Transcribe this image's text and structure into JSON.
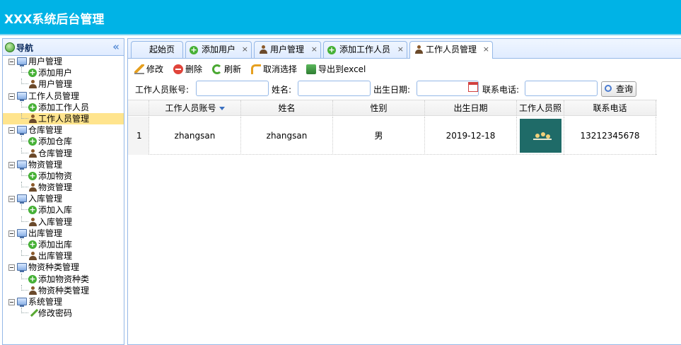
{
  "app": {
    "title": "XXX系统后台管理"
  },
  "sidebar": {
    "title": "导航",
    "collapse_glyph": "«",
    "groups": [
      {
        "label": "用户管理",
        "children": [
          "添加用户",
          "用户管理"
        ]
      },
      {
        "label": "工作人员管理",
        "children": [
          "添加工作人员",
          "工作人员管理"
        ]
      },
      {
        "label": "仓库管理",
        "children": [
          "添加仓库",
          "仓库管理"
        ]
      },
      {
        "label": "物资管理",
        "children": [
          "添加物资",
          "物资管理"
        ]
      },
      {
        "label": "入库管理",
        "children": [
          "添加入库",
          "入库管理"
        ]
      },
      {
        "label": "出库管理",
        "children": [
          "添加出库",
          "出库管理"
        ]
      },
      {
        "label": "物资种类管理",
        "children": [
          "添加物资种类",
          "物资种类管理"
        ]
      },
      {
        "label": "系统管理",
        "children": [
          "修改密码"
        ]
      }
    ],
    "selected": "工作人员管理"
  },
  "tabs": [
    {
      "label": "起始页",
      "icon": "none",
      "closable": false
    },
    {
      "label": "添加用户",
      "icon": "plus-icon",
      "closable": true
    },
    {
      "label": "用户管理",
      "icon": "user-icon",
      "closable": true
    },
    {
      "label": "添加工作人员",
      "icon": "plus-icon",
      "closable": true
    },
    {
      "label": "工作人员管理",
      "icon": "user-icon",
      "closable": true,
      "active": true
    }
  ],
  "tab_close_glyph": "×",
  "toolbar": {
    "edit": "修改",
    "delete": "删除",
    "refresh": "刷新",
    "unselect": "取消选择",
    "export": "导出到excel"
  },
  "search": {
    "account_label": "工作人员账号:",
    "name_label": "姓名:",
    "birth_label": "出生日期:",
    "phone_label": "联系电话:",
    "button": "查询",
    "account_value": "",
    "name_value": "",
    "birth_value": "",
    "phone_value": ""
  },
  "table": {
    "columns": [
      "工作人员账号",
      "姓名",
      "性别",
      "出生日期",
      "工作人员照",
      "联系电话"
    ],
    "rows": [
      {
        "num": "1",
        "account": "zhangsan",
        "name": "zhangsan",
        "gender": "男",
        "birth": "2019-12-18",
        "phone": "13212345678"
      }
    ]
  }
}
